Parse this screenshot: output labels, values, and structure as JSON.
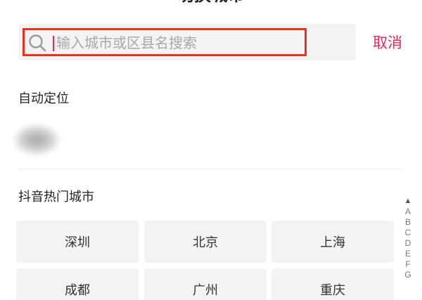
{
  "header": {
    "title": "切换城市",
    "back_icon": "close-x-icon"
  },
  "search": {
    "placeholder": "输入城市或区县名搜索",
    "value": "",
    "icon": "search-icon",
    "cancel_label": "取消",
    "accent_color": "#e6285a",
    "highlight_color": "#e8341c"
  },
  "auto_locate": {
    "title": "自动定位"
  },
  "hot_cities": {
    "title": "抖音热门城市",
    "rows": [
      [
        "深圳",
        "北京",
        "上海"
      ],
      [
        "成都",
        "广州",
        "重庆"
      ]
    ]
  },
  "alphabet_index": {
    "arrow": "▲",
    "letters": [
      "A",
      "B",
      "C",
      "D",
      "E",
      "F",
      "G"
    ]
  }
}
